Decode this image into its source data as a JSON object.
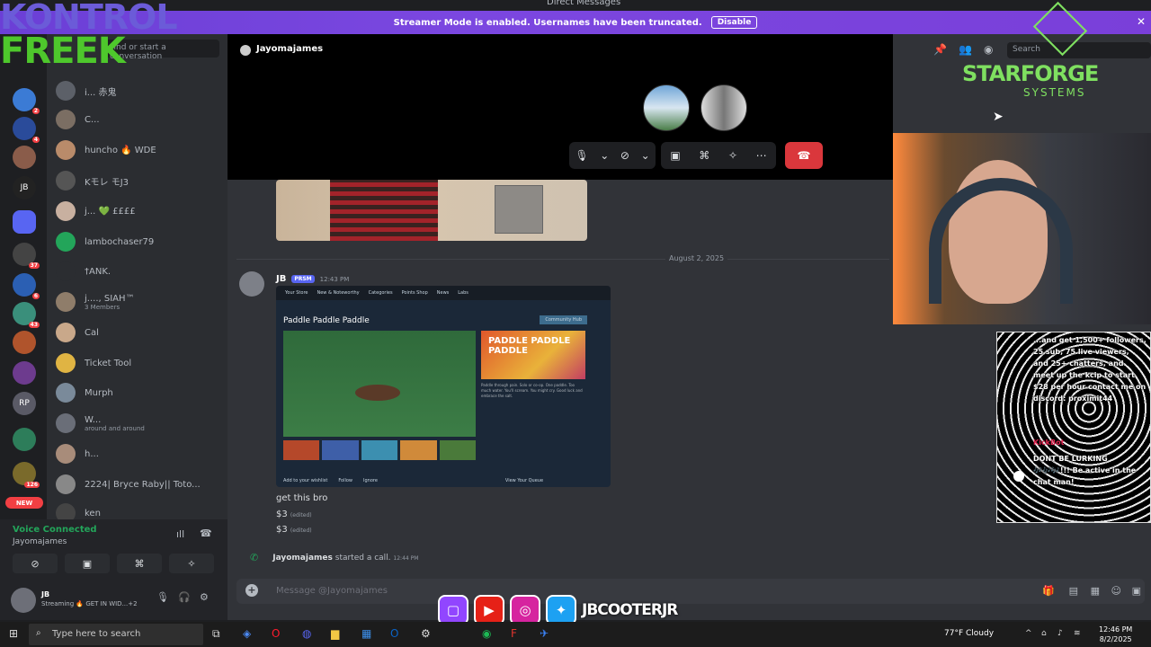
{
  "window": {
    "title": "Direct Messages"
  },
  "banner": {
    "text": "Streamer Mode is enabled. Usernames have been truncated.",
    "button": "Disable"
  },
  "dm_list": {
    "search_placeholder": "Find or start a conversation",
    "items": [
      {
        "name": "i... 赤鬼",
        "sub": ""
      },
      {
        "name": "C...",
        "sub": ""
      },
      {
        "name": "huncho 🔥 WDE",
        "sub": ""
      },
      {
        "name": "Kモレ モJ3",
        "sub": ""
      },
      {
        "name": "j... 💚 ££££",
        "sub": ""
      },
      {
        "name": "lambochaser79",
        "sub": ""
      },
      {
        "name": "†ANK.",
        "sub": ""
      },
      {
        "name": "j...., SIAH™",
        "sub": "3 Members"
      },
      {
        "name": "Cal",
        "sub": ""
      },
      {
        "name": "Ticket Tool",
        "sub": ""
      },
      {
        "name": "Murph",
        "sub": ""
      },
      {
        "name": "W...",
        "sub": "around and around"
      },
      {
        "name": "h...",
        "sub": ""
      },
      {
        "name": "2224| Bryce Raby|| Toto...",
        "sub": ""
      },
      {
        "name": "ken",
        "sub": ""
      }
    ]
  },
  "rail": {
    "badges": [
      "2",
      "4",
      "37",
      "6",
      "43",
      "126"
    ],
    "new_label": "NEW"
  },
  "voice": {
    "status": "Voice Connected",
    "channel": "Jayomajames"
  },
  "user": {
    "name": "JB",
    "status": "Streaming 🔥 GET IN WID...+2"
  },
  "call": {
    "header_name": "Jayomajames",
    "search_placeholder": "Search"
  },
  "messages": {
    "date_divider": "August 2, 2025",
    "author": "JB",
    "author_tag": "PRSM",
    "time": "12:43 PM",
    "steam": {
      "nav": [
        "Your Store",
        "New & Noteworthy",
        "Categories",
        "Points Shop",
        "News",
        "Labs"
      ],
      "game_title": "Paddle Paddle Paddle",
      "hub_label": "Community Hub",
      "capsule_text": "PADDLE PADDLE PADDLE",
      "description": "Paddle through pain. Solo or co-op. One paddle. Too much water. You'll scream. You might cry. Good luck and embrace the salt.",
      "bottom": [
        "Add to your wishlist",
        "Follow",
        "Ignore",
        "View Your Queue"
      ]
    },
    "lines": [
      {
        "text": "get this bro",
        "edited": ""
      },
      {
        "text": "$3",
        "edited": "(edited)"
      },
      {
        "text": "$3",
        "edited": "(edited)"
      }
    ],
    "call_author": "Jayomajames",
    "call_text": "started a call.",
    "call_time": "12:44 PM",
    "composer_placeholder": "Message @Jayomajames"
  },
  "overlay": {
    "logo_top": "KONTROL",
    "logo_bottom": "FREEK",
    "sponsor": "STARFORGE",
    "sponsor_sub": "SYSTEMS",
    "chat_lines": [
      "...and get 1,500+ followers, 25 sub, 75 live viewers, and 25+ chatters, and meet up the kcip to start $28 per hour contact me on discord: proximit44"
    ],
    "chat_user": "KickBot",
    "chat_msg": "DONT BE LURKING 🎶🎶🎶!!! Be active in the chat man!",
    "handle": "JBCOOTERJR"
  },
  "taskbar": {
    "search_placeholder": "Type here to search",
    "weather": "77°F  Cloudy",
    "time": "12:46 PM",
    "date": "8/2/2025"
  }
}
